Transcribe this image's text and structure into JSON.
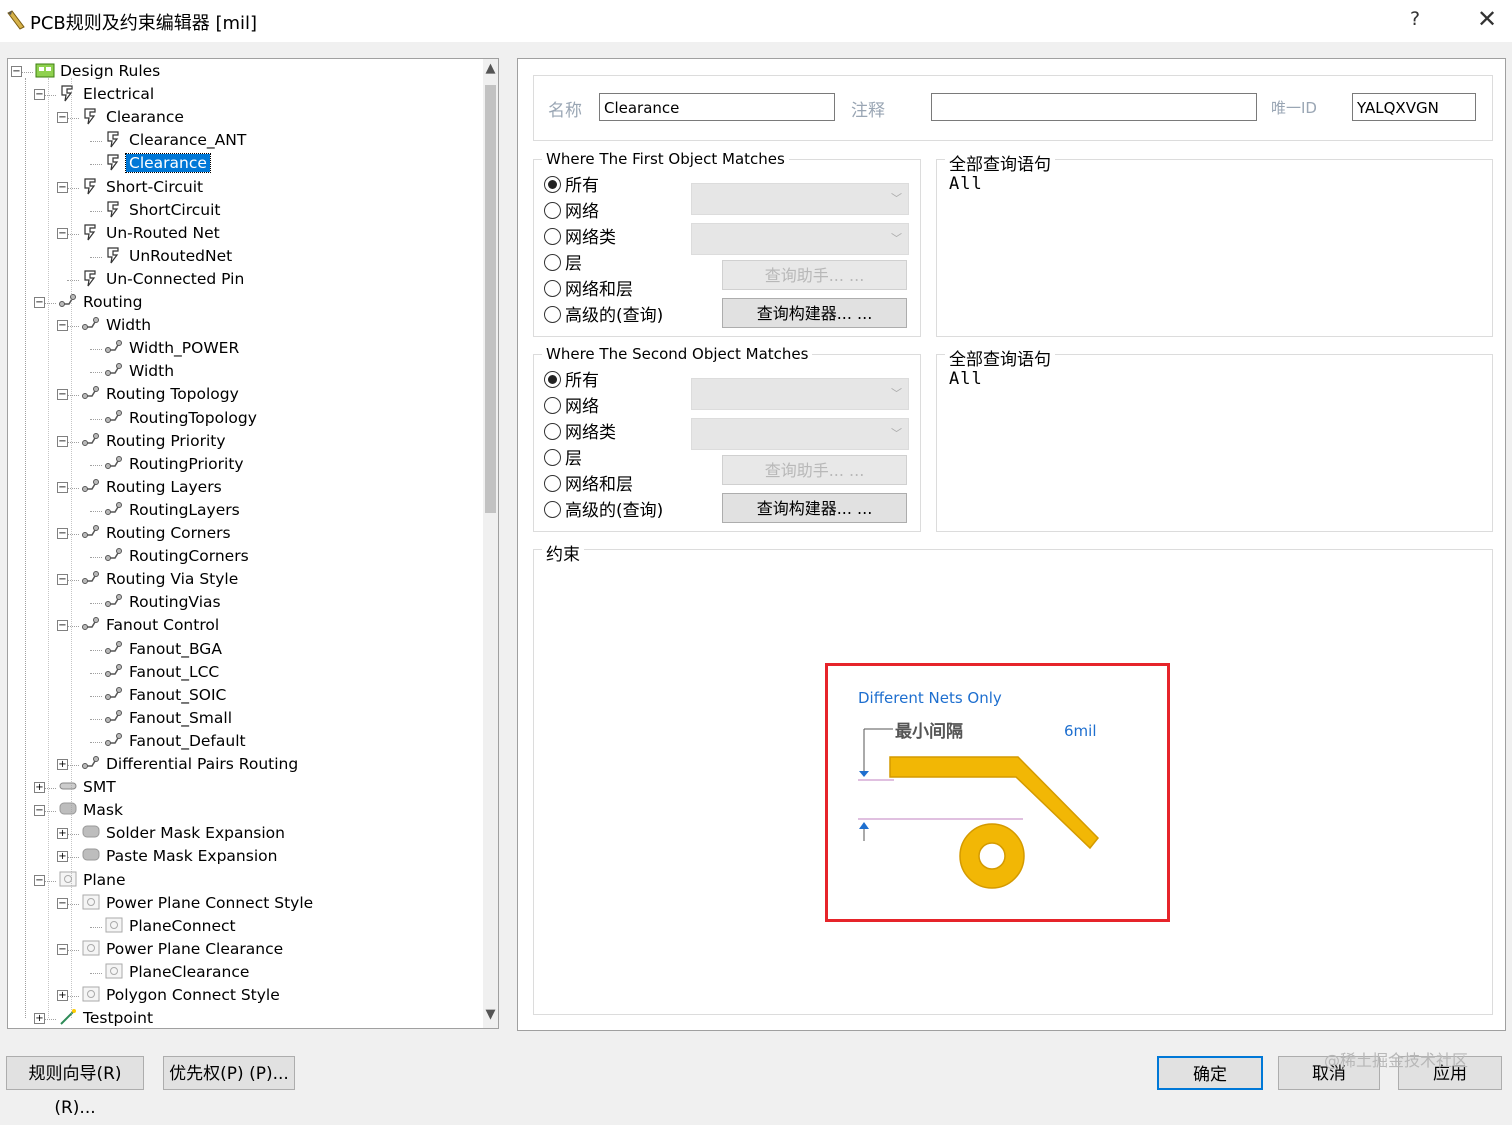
{
  "window": {
    "title": "PCB规则及约束编辑器 [mil]",
    "help": "?",
    "close": "✕"
  },
  "tree": {
    "items": [
      {
        "label": "Design Rules",
        "level": 0,
        "icon": "design-rules-icon",
        "expander": "−"
      },
      {
        "label": "Electrical",
        "level": 1,
        "icon": "electrical-icon",
        "expander": "−"
      },
      {
        "label": "Clearance",
        "level": 2,
        "icon": "electrical-icon",
        "expander": "−"
      },
      {
        "label": "Clearance_ANT",
        "level": 3,
        "icon": "electrical-icon",
        "expander": ""
      },
      {
        "label": "Clearance",
        "level": 3,
        "icon": "electrical-icon",
        "expander": "",
        "selected": true
      },
      {
        "label": "Short-Circuit",
        "level": 2,
        "icon": "electrical-icon",
        "expander": "−"
      },
      {
        "label": "ShortCircuit",
        "level": 3,
        "icon": "electrical-icon",
        "expander": ""
      },
      {
        "label": "Un-Routed Net",
        "level": 2,
        "icon": "electrical-icon",
        "expander": "−"
      },
      {
        "label": "UnRoutedNet",
        "level": 3,
        "icon": "electrical-icon",
        "expander": ""
      },
      {
        "label": "Un-Connected Pin",
        "level": 2,
        "icon": "electrical-icon",
        "expander": ""
      },
      {
        "label": "Routing",
        "level": 1,
        "icon": "routing-icon",
        "expander": "−"
      },
      {
        "label": "Width",
        "level": 2,
        "icon": "routing-icon",
        "expander": "−"
      },
      {
        "label": "Width_POWER",
        "level": 3,
        "icon": "routing-icon",
        "expander": ""
      },
      {
        "label": "Width",
        "level": 3,
        "icon": "routing-icon",
        "expander": ""
      },
      {
        "label": "Routing Topology",
        "level": 2,
        "icon": "routing-icon",
        "expander": "−"
      },
      {
        "label": "RoutingTopology",
        "level": 3,
        "icon": "routing-icon",
        "expander": ""
      },
      {
        "label": "Routing Priority",
        "level": 2,
        "icon": "routing-icon",
        "expander": "−"
      },
      {
        "label": "RoutingPriority",
        "level": 3,
        "icon": "routing-icon",
        "expander": ""
      },
      {
        "label": "Routing Layers",
        "level": 2,
        "icon": "routing-icon",
        "expander": "−"
      },
      {
        "label": "RoutingLayers",
        "level": 3,
        "icon": "routing-icon",
        "expander": ""
      },
      {
        "label": "Routing Corners",
        "level": 2,
        "icon": "routing-icon",
        "expander": "−"
      },
      {
        "label": "RoutingCorners",
        "level": 3,
        "icon": "routing-icon",
        "expander": ""
      },
      {
        "label": "Routing Via Style",
        "level": 2,
        "icon": "routing-icon",
        "expander": "−"
      },
      {
        "label": "RoutingVias",
        "level": 3,
        "icon": "routing-icon",
        "expander": ""
      },
      {
        "label": "Fanout Control",
        "level": 2,
        "icon": "routing-icon",
        "expander": "−"
      },
      {
        "label": "Fanout_BGA",
        "level": 3,
        "icon": "routing-icon",
        "expander": ""
      },
      {
        "label": "Fanout_LCC",
        "level": 3,
        "icon": "routing-icon",
        "expander": ""
      },
      {
        "label": "Fanout_SOIC",
        "level": 3,
        "icon": "routing-icon",
        "expander": ""
      },
      {
        "label": "Fanout_Small",
        "level": 3,
        "icon": "routing-icon",
        "expander": ""
      },
      {
        "label": "Fanout_Default",
        "level": 3,
        "icon": "routing-icon",
        "expander": ""
      },
      {
        "label": "Differential Pairs Routing",
        "level": 2,
        "icon": "routing-icon",
        "expander": "+"
      },
      {
        "label": "SMT",
        "level": 1,
        "icon": "smt-icon",
        "expander": "+"
      },
      {
        "label": "Mask",
        "level": 1,
        "icon": "mask-icon",
        "expander": "−"
      },
      {
        "label": "Solder Mask Expansion",
        "level": 2,
        "icon": "mask-icon",
        "expander": "+"
      },
      {
        "label": "Paste Mask Expansion",
        "level": 2,
        "icon": "mask-icon",
        "expander": "+"
      },
      {
        "label": "Plane",
        "level": 1,
        "icon": "plane-icon",
        "expander": "−"
      },
      {
        "label": "Power Plane Connect Style",
        "level": 2,
        "icon": "plane-icon",
        "expander": "−"
      },
      {
        "label": "PlaneConnect",
        "level": 3,
        "icon": "plane-icon",
        "expander": ""
      },
      {
        "label": "Power Plane Clearance",
        "level": 2,
        "icon": "plane-icon",
        "expander": "−"
      },
      {
        "label": "PlaneClearance",
        "level": 3,
        "icon": "plane-icon",
        "expander": ""
      },
      {
        "label": "Polygon Connect Style",
        "level": 2,
        "icon": "plane-icon",
        "expander": "+"
      },
      {
        "label": "Testpoint",
        "level": 1,
        "icon": "testpoint-icon",
        "expander": "+"
      }
    ]
  },
  "rule": {
    "name_label": "名称",
    "name_value": "Clearance",
    "comment_label": "注释",
    "comment_value": "",
    "uid_label": "唯一ID",
    "uid_value": "YALQXVGN"
  },
  "first_match": {
    "title": "Where The First Object Matches",
    "options": [
      "所有",
      "网络",
      "网络类",
      "层",
      "网络和层",
      "高级的(查询)"
    ],
    "selected": 0,
    "query_helper": "查询助手... ...",
    "query_builder": "查询构建器... ...",
    "query_title": "全部查询语句",
    "query_text": "All"
  },
  "second_match": {
    "title": "Where The Second Object Matches",
    "options": [
      "所有",
      "网络",
      "网络类",
      "层",
      "网络和层",
      "高级的(查询)"
    ],
    "selected": 0,
    "query_helper": "查询助手... ...",
    "query_builder": "查询构建器... ...",
    "query_title": "全部查询语句",
    "query_text": "All"
  },
  "constraints": {
    "title": "约束",
    "scope": "Different Nets Only",
    "min_clearance_label": "最小间隔",
    "min_clearance_value": "6mil",
    "colors": {
      "track": "#f2b705",
      "highlight_border": "#e6242a",
      "link_blue": "#1e6fcf"
    }
  },
  "footer": {
    "rule_wizard": "规则向导(R) (R)...",
    "priorities": "优先权(P) (P)...",
    "ok": "确定",
    "cancel": "取消",
    "apply": "应用",
    "watermark": "@稀土掘金技术社区"
  }
}
